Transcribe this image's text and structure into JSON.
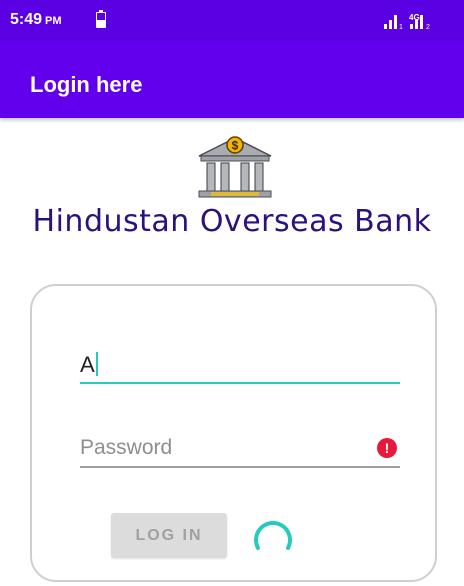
{
  "status_bar": {
    "time": "5:49",
    "ampm": "PM",
    "network": "4G",
    "sim_index": "1",
    "sim2_index": "2",
    "icons": [
      "battery-icon",
      "signal-icon"
    ]
  },
  "app_bar": {
    "title": "Login here"
  },
  "header": {
    "logo_icon": "bank-building-icon",
    "logo_symbol": "$",
    "bank_name": "Hindustan Overseas Bank"
  },
  "form": {
    "username_value": "A",
    "password_placeholder": "Password",
    "password_error_icon": "!",
    "login_label": "LOG IN",
    "loading_icon": "progress-spinner"
  },
  "colors": {
    "status_bar": "#5b00e3",
    "app_bar": "#6200ee",
    "bank_name": "#2b117e",
    "accent": "#25cbbb",
    "error": "#e8173c",
    "button_bg": "#dcdcdc",
    "button_text": "#a0a0a0"
  }
}
